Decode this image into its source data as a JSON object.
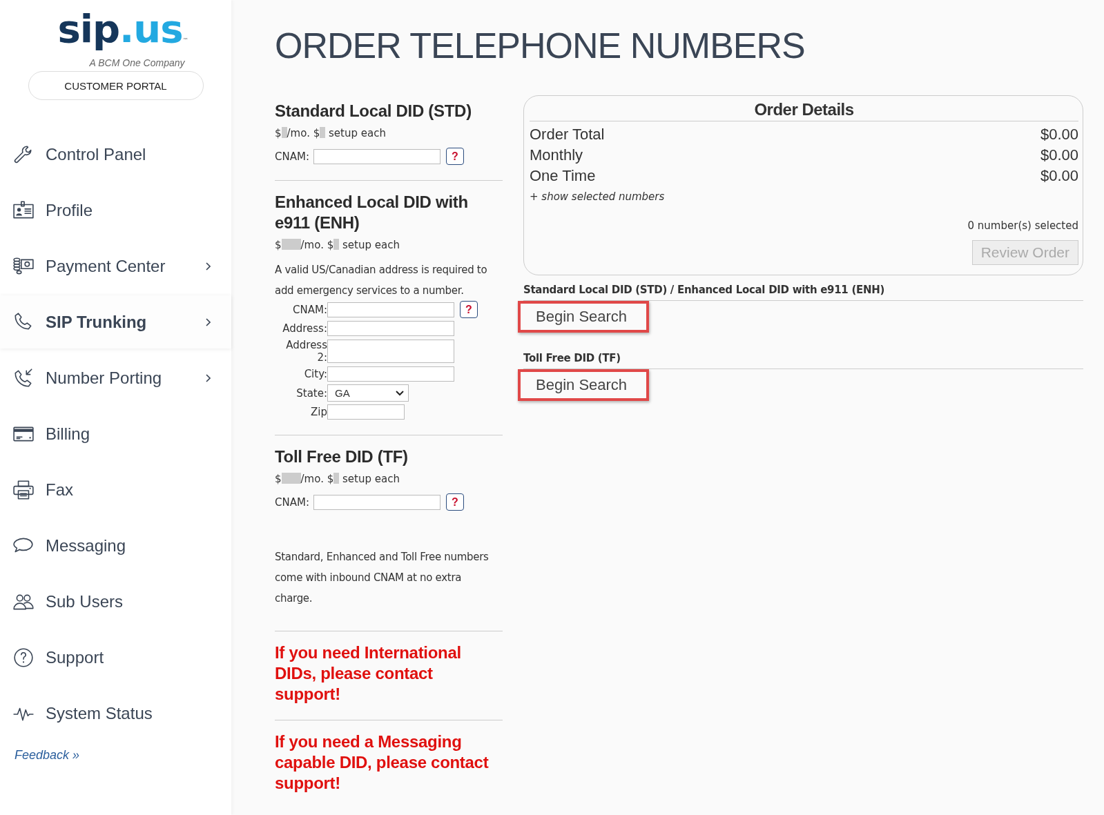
{
  "sidebar": {
    "logo": {
      "dark": "sip",
      "light": ".us",
      "tm": "™",
      "tagline": "A BCM One Company"
    },
    "portal_label": "CUSTOMER PORTAL",
    "items": [
      {
        "label": "Control Panel",
        "selected": false,
        "submenu": false
      },
      {
        "label": "Profile",
        "selected": false,
        "submenu": false
      },
      {
        "label": "Payment Center",
        "selected": false,
        "submenu": true
      },
      {
        "label": "SIP Trunking",
        "selected": true,
        "submenu": true
      },
      {
        "label": "Number Porting",
        "selected": false,
        "submenu": true
      },
      {
        "label": "Billing",
        "selected": false,
        "submenu": false
      },
      {
        "label": "Fax",
        "selected": false,
        "submenu": false
      },
      {
        "label": "Messaging",
        "selected": false,
        "submenu": false
      },
      {
        "label": "Sub Users",
        "selected": false,
        "submenu": false
      },
      {
        "label": "Support",
        "selected": false,
        "submenu": false
      },
      {
        "label": "System Status",
        "selected": false,
        "submenu": false
      }
    ],
    "feedback": "Feedback »"
  },
  "page_title": "ORDER TELEPHONE NUMBERS",
  "sections": [
    {
      "kind": "product",
      "title": "Standard Local DID (STD)",
      "price": [
        {
          "kind": "text",
          "text": "$"
        },
        {
          "kind": "redacted"
        },
        {
          "kind": "text",
          "text": "/mo. $"
        },
        {
          "kind": "redacted"
        },
        {
          "kind": "text",
          "text": " setup each"
        }
      ],
      "fields": [
        {
          "kind": "text",
          "label": "CNAM:",
          "help": "?"
        }
      ]
    },
    {
      "kind": "product",
      "title": "Enhanced Local DID with e911 (ENH)",
      "price": [
        {
          "kind": "text",
          "text": "$"
        },
        {
          "kind": "redactedwide"
        },
        {
          "kind": "text",
          "text": "/mo. $"
        },
        {
          "kind": "redacted"
        },
        {
          "kind": "text",
          "text": " setup each"
        }
      ],
      "note": "A valid US/Canadian address is required to add emergency services to a number.",
      "fields": [
        {
          "kind": "text",
          "label": "CNAM:",
          "help": "?"
        },
        {
          "kind": "text",
          "label": "Address:"
        },
        {
          "kind": "text",
          "label": "Address 2:",
          "tall": true
        },
        {
          "kind": "text",
          "label": "City:"
        },
        {
          "kind": "select",
          "label": "State:",
          "value": "GA"
        },
        {
          "kind": "short",
          "label": "Zip"
        }
      ]
    },
    {
      "kind": "product",
      "title": "Toll Free DID (TF)",
      "price": [
        {
          "kind": "text",
          "text": "$"
        },
        {
          "kind": "redactedwide"
        },
        {
          "kind": "text",
          "text": "/mo. $"
        },
        {
          "kind": "redacted"
        },
        {
          "kind": "text",
          "text": " setup each"
        }
      ],
      "fields": [
        {
          "kind": "text",
          "label": "CNAM:",
          "help": "?"
        }
      ],
      "footnote": "Standard, Enhanced and Toll Free numbers come with inbound CNAM at no extra charge."
    },
    {
      "kind": "alert",
      "text": "If you need International DIDs, please contact support!"
    },
    {
      "kind": "alert",
      "text": "If you need a Messaging capable DID, please contact support!"
    }
  ],
  "order_details": {
    "title": "Order Details",
    "rows": [
      {
        "label": "Order Total",
        "value": "$0.00"
      },
      {
        "label": "Monthly",
        "value": "$0.00"
      },
      {
        "label": "One Time",
        "value": "$0.00"
      }
    ],
    "toggle": "+ show selected numbers",
    "count": "0 number(s) selected",
    "review_button": {
      "label": "Review Order",
      "disabled": true
    }
  },
  "searches": [
    {
      "heading": "Standard Local DID (STD) / Enhanced Local DID with e911 (ENH)",
      "button": "Begin Search",
      "highlighted": true
    },
    {
      "heading": "Toll Free DID (TF)",
      "button": "Begin Search",
      "highlighted": true
    }
  ]
}
